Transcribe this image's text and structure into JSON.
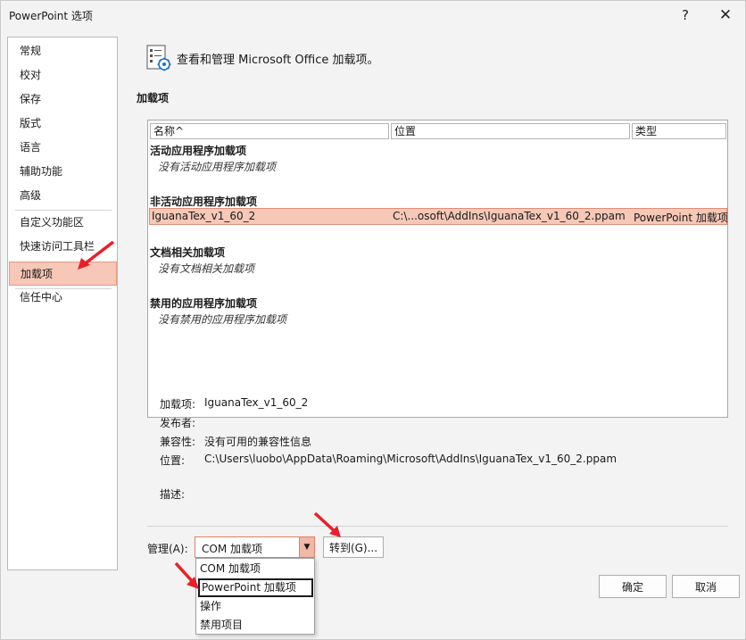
{
  "window": {
    "title": "PowerPoint 选项",
    "help_glyph": "?",
    "close_glyph": "✕"
  },
  "nav": {
    "items": [
      {
        "label": "常规"
      },
      {
        "label": "校对"
      },
      {
        "label": "保存"
      },
      {
        "label": "版式"
      },
      {
        "label": "语言"
      },
      {
        "label": "辅助功能"
      },
      {
        "label": "高级"
      },
      {
        "label": "自定义功能区"
      },
      {
        "label": "快速访问工具栏"
      },
      {
        "label": "加载项",
        "selected": true
      },
      {
        "label": "信任中心"
      }
    ]
  },
  "header": {
    "icon": "addins-gear-icon",
    "text": "查看和管理 Microsoft Office 加载项。"
  },
  "section": {
    "title": "加载项"
  },
  "list": {
    "columns": {
      "name": "名称^",
      "location": "位置",
      "type": "类型"
    },
    "groups": {
      "active": {
        "title": "活动应用程序加载项",
        "empty": "没有活动应用程序加载项"
      },
      "inactive": {
        "title": "非活动应用程序加载项",
        "row": {
          "name": "IguanaTex_v1_60_2",
          "location": "C:\\...osoft\\AddIns\\IguanaTex_v1_60_2.ppam",
          "type": "PowerPoint 加载项"
        }
      },
      "document": {
        "title": "文档相关加载项",
        "empty": "没有文档相关加载项"
      },
      "disabled": {
        "title": "禁用的应用程序加载项",
        "empty": "没有禁用的应用程序加载项"
      }
    }
  },
  "details": {
    "addin_label": "加载项:",
    "addin_value": "IguanaTex_v1_60_2",
    "publisher_label": "发布者:",
    "publisher_value": "",
    "compat_label": "兼容性:",
    "compat_value": "没有可用的兼容性信息",
    "location_label": "位置:",
    "location_value": "C:\\Users\\luobo\\AppData\\Roaming\\Microsoft\\AddIns\\IguanaTex_v1_60_2.ppam",
    "desc_label": "描述:",
    "desc_value": ""
  },
  "manage": {
    "label": "管理(A):",
    "selected": "COM 加载项",
    "goto_label": "转到(G)...",
    "options": [
      "COM 加载项",
      "PowerPoint 加载项",
      "操作",
      "禁用项目"
    ],
    "highlighted_index": 1
  },
  "buttons": {
    "ok": "确定",
    "cancel": "取消"
  },
  "colors": {
    "selection": "#f5c8b8",
    "accent": "#e08060",
    "annotation_arrow": "#e8202a"
  }
}
